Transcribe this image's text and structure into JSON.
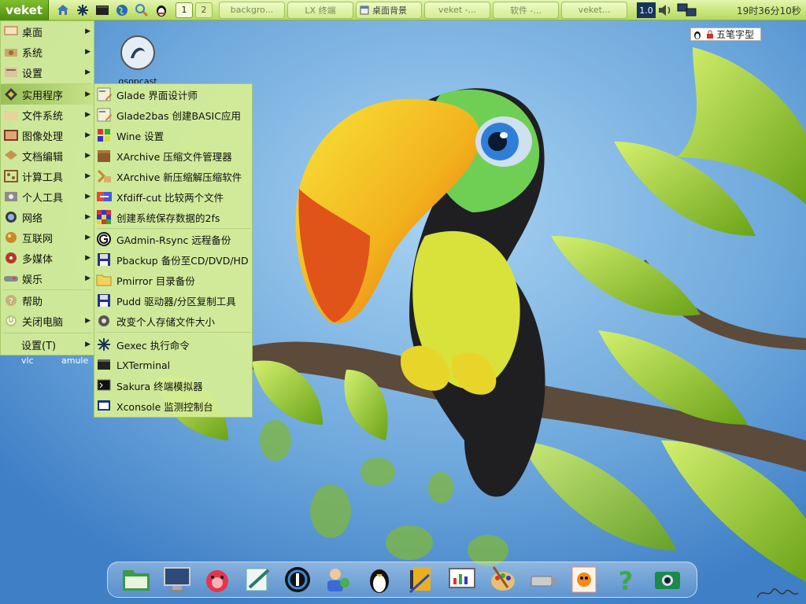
{
  "panel": {
    "start_label": "veket",
    "launchers": [
      "home-icon",
      "asterisk-icon",
      "terminal-icon",
      "globe-icon",
      "search-icon",
      "qq-penguin-icon"
    ],
    "workspaces": [
      "1",
      "2"
    ],
    "tasks": [
      "backgro...",
      "LX 终端",
      "桌面背景",
      "veket -...",
      "软件 -...",
      "veket..."
    ],
    "cpu": "1.0",
    "clock": "19时36分10秒"
  },
  "ime": {
    "label": "五笔字型"
  },
  "desktop": {
    "icons": {
      "qsopcast": "qsopcast",
      "vlc": "vlc",
      "amule": "amule"
    }
  },
  "main_menu": {
    "items": [
      "桌面",
      "系统",
      "设置",
      "实用程序",
      "文件系统",
      "图像处理",
      "文档编辑",
      "计算工具",
      "个人工具",
      "网络",
      "互联网",
      "多媒体",
      "娱乐",
      "帮助",
      "关闭电脑",
      "设置(T)"
    ]
  },
  "sub_menu": {
    "items": [
      "Glade 界面设计师",
      "Glade2bas 创建BASIC应用",
      "Wine 设置",
      "XArchive 压缩文件管理器",
      "XArchive 新压缩解压缩软件",
      "Xfdiff-cut 比较两个文件",
      "创建系统保存数据的2fs",
      "GAdmin-Rsync 远程备份",
      "Pbackup 备份至CD/DVD/HD",
      "Pmirror 目录备份",
      "Pudd 驱动器/分区复制工具",
      "改变个人存储文件大小",
      "Gexec 执行命令",
      "LXTerminal",
      "Sakura 终端模拟器",
      "Xconsole 监测控制台"
    ]
  },
  "dock": {
    "items": [
      "file-manager-icon",
      "monitor-icon",
      "pig-mascot-icon",
      "text-editor-icon",
      "media-player-icon",
      "user-accounts-icon",
      "penguin-icon",
      "notebook-icon",
      "presentation-icon",
      "paint-palette-icon",
      "usb-drive-icon",
      "game-card-icon",
      "help-icon",
      "camera-icon"
    ]
  },
  "colors": {
    "panel": "#c9e77c",
    "menu": "#d6ee94",
    "highlight": "#98bf55",
    "sky": "#7fb3e6"
  }
}
